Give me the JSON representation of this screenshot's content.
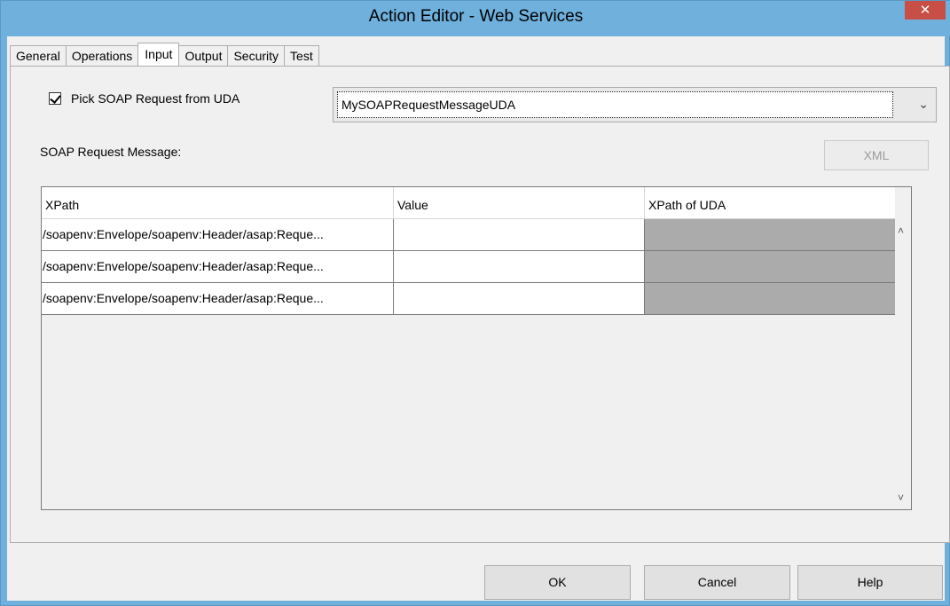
{
  "window": {
    "title": "Action Editor - Web Services",
    "close_glyph": "✕"
  },
  "tabs": [
    {
      "label": "General"
    },
    {
      "label": "Operations"
    },
    {
      "label": "Input"
    },
    {
      "label": "Output"
    },
    {
      "label": "Security"
    },
    {
      "label": "Test"
    }
  ],
  "active_tab": "Input",
  "pick_soap": {
    "checked": true,
    "label": "Pick SOAP Request from UDA"
  },
  "uda_select": {
    "value": "MySOAPRequestMessageUDA",
    "arrow_glyph": "⌄"
  },
  "request_message_label": "SOAP Request Message:",
  "xml_button_label": "XML",
  "grid": {
    "columns": [
      "XPath",
      "Value",
      "XPath of UDA"
    ],
    "rows": [
      {
        "xpath": "/soapenv:Envelope/soapenv:Header/asap:Reque...",
        "value": "",
        "xpath_of_uda": ""
      },
      {
        "xpath": "/soapenv:Envelope/soapenv:Header/asap:Reque...",
        "value": "",
        "xpath_of_uda": ""
      },
      {
        "xpath": "/soapenv:Envelope/soapenv:Header/asap:Reque...",
        "value": "",
        "xpath_of_uda": ""
      }
    ],
    "scroll_up_glyph": "˄",
    "scroll_down_glyph": "˅"
  },
  "buttons": {
    "ok": "OK",
    "cancel": "Cancel",
    "help": "Help"
  },
  "colors": {
    "titlebar": "#6fb0dd",
    "close_button": "#c74f45",
    "readonly_cell": "#ababab"
  }
}
